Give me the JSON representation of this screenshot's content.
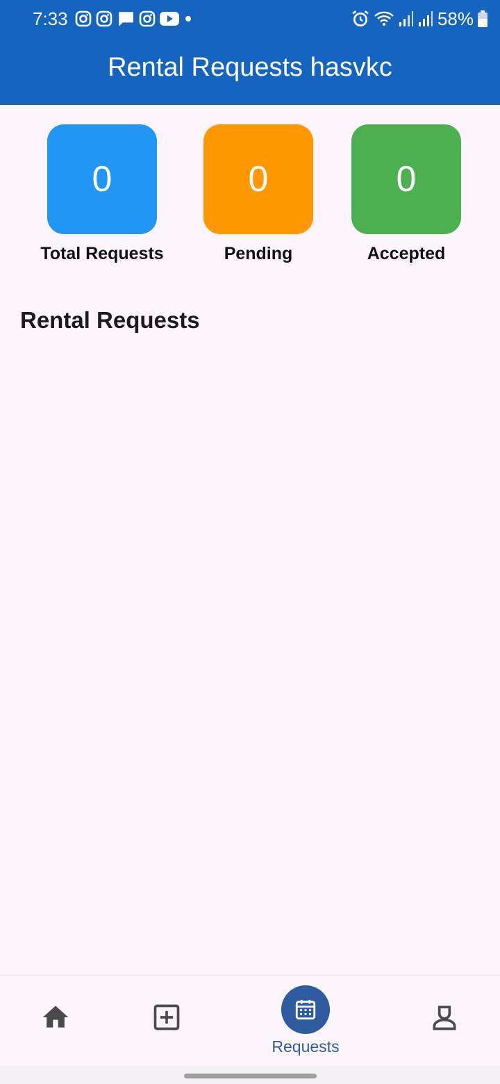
{
  "status_bar": {
    "time": "7:33",
    "notification_icons": [
      "instagram-icon",
      "instagram-icon",
      "message-icon",
      "instagram-icon",
      "youtube-icon",
      "dot-icon"
    ],
    "system_icons": [
      "alarm-icon",
      "wifi-icon",
      "signal-icon",
      "signal-icon",
      "battery-icon"
    ],
    "battery": "58%"
  },
  "app_bar": {
    "title": "Rental Requests hasvkc",
    "color": "#1565c0"
  },
  "stats": [
    {
      "value": "0",
      "label": "Total Requests",
      "color": "#2196f3"
    },
    {
      "value": "0",
      "label": "Pending",
      "color": "#ff9800"
    },
    {
      "value": "0",
      "label": "Accepted",
      "color": "#4caf50"
    }
  ],
  "section": {
    "title": "Rental Requests"
  },
  "bottom_nav": {
    "items": [
      {
        "icon": "home-icon",
        "label": ""
      },
      {
        "icon": "add-box-icon",
        "label": ""
      },
      {
        "icon": "calendar-icon",
        "label": "Requests",
        "active": true
      },
      {
        "icon": "profile-icon",
        "label": ""
      }
    ],
    "active_color": "#2f5ca0"
  }
}
